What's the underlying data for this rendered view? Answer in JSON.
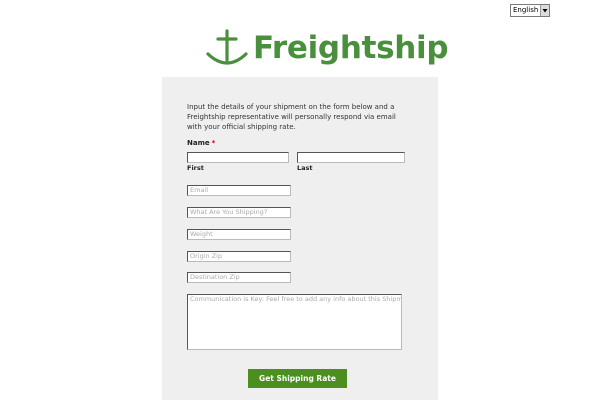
{
  "language_select": {
    "selected": "English"
  },
  "logo": {
    "icon": "anchor-icon",
    "text": "Freightship",
    "color": "#4a8f3d"
  },
  "form": {
    "intro": "Input the details of your shipment on the form below and a Freightship representative will personally respond via email with your official shipping rate.",
    "name_label": "Name",
    "required_mark": "*",
    "first": {
      "value": "",
      "sublabel": "First"
    },
    "last": {
      "value": "",
      "sublabel": "Last"
    },
    "email": {
      "placeholder": "Email"
    },
    "what_shipping": {
      "placeholder": "What Are You Shipping?"
    },
    "weight": {
      "placeholder": "Weight"
    },
    "origin_zip": {
      "placeholder": "Origin Zip"
    },
    "destination_zip": {
      "placeholder": "Destination Zip"
    },
    "message": {
      "placeholder": "Communication is Key: Feel free to add any info about this Shipment"
    },
    "submit_label": "Get Shipping Rate",
    "submit_color": "#4c8f1e"
  }
}
